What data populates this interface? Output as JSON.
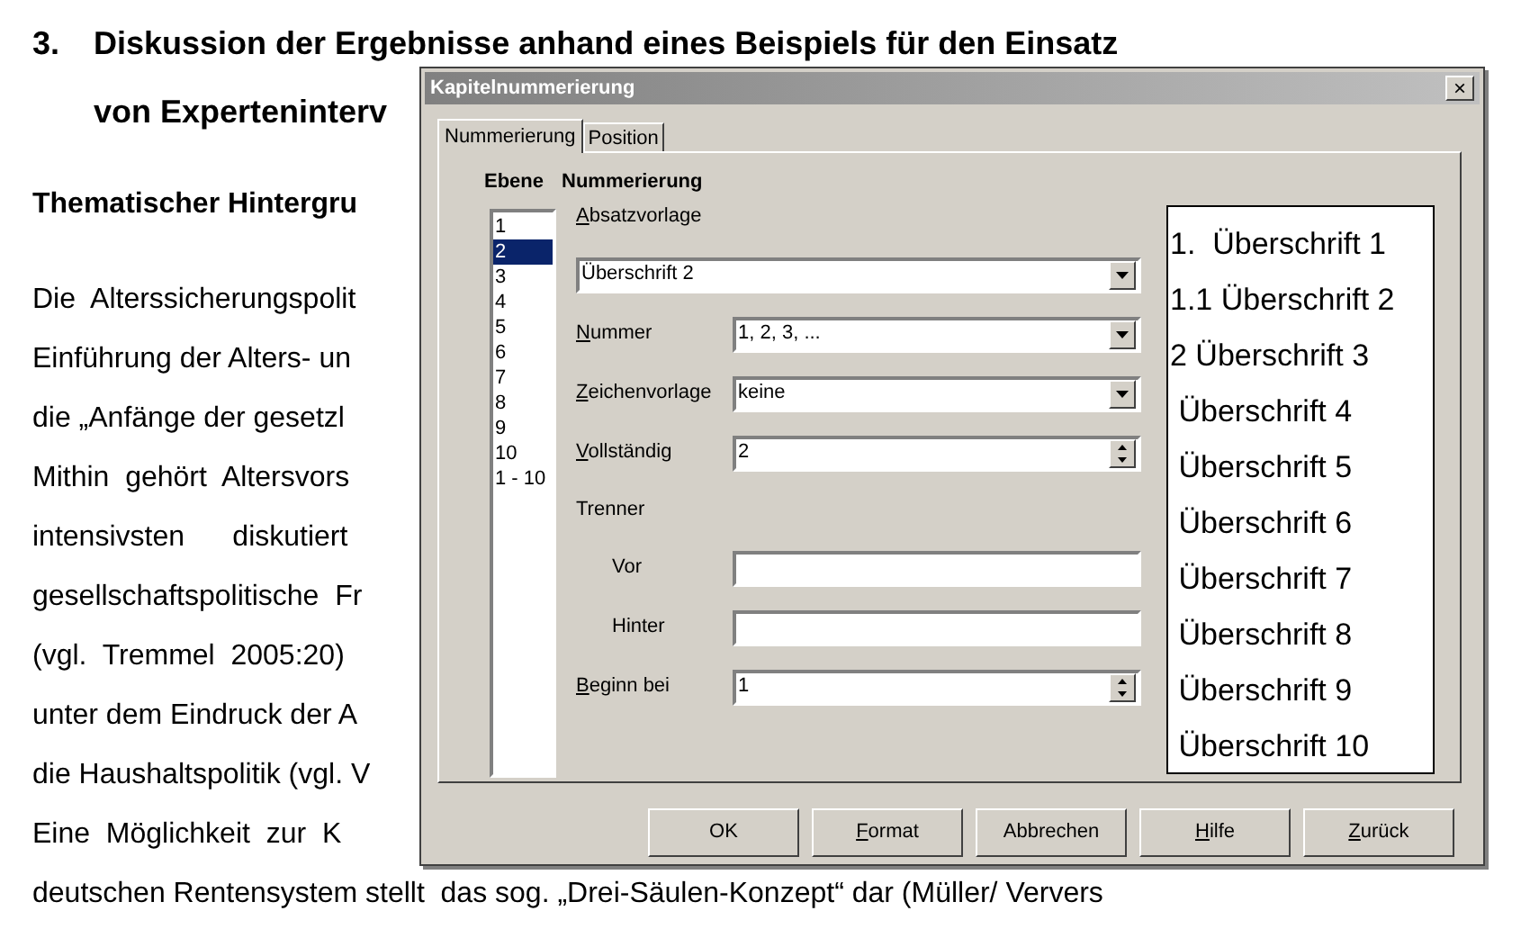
{
  "document": {
    "heading_number": "3.",
    "heading_lines": [
      "Diskussion der Ergebnisse anhand eines Beispiels für den Einsatz",
      "von Experteninterv"
    ],
    "subheading": "Thematischer Hintergru",
    "lines": [
      "Die  Alterssicherungspolit",
      "Einführung der Alters- un",
      "die „Anfänge der gesetzl",
      "Mithin  gehört  Altersvors",
      "intensivsten      diskutiert",
      "gesellschaftspolitische  Fr",
      "(vgl.  Tremmel  2005:20)",
      "unter dem Eindruck der A",
      "die Haushaltspolitik (vgl. V",
      "Eine  Möglichkeit  zur  K",
      "deutschen Rentensystem stellt  das sog. „Drei-Säulen-Konzept“ dar (Müller/ Ververs"
    ]
  },
  "dialog": {
    "title": "Kapitelnummerierung",
    "close": "×",
    "tabs": [
      {
        "label": "Nummerierung",
        "selected": true
      },
      {
        "label": "Position",
        "selected": false
      }
    ],
    "level_header": "Ebene",
    "numbering_header": "Nummerierung",
    "levels": [
      {
        "label": "1",
        "selected": false
      },
      {
        "label": "2",
        "selected": true
      },
      {
        "label": "3",
        "selected": false
      },
      {
        "label": "4",
        "selected": false
      },
      {
        "label": "5",
        "selected": false
      },
      {
        "label": "6",
        "selected": false
      },
      {
        "label": "7",
        "selected": false
      },
      {
        "label": "8",
        "selected": false
      },
      {
        "label": "9",
        "selected": false
      },
      {
        "label": "10",
        "selected": false
      },
      {
        "label": "1 - 10",
        "selected": false
      }
    ],
    "fields": [
      {
        "kind": "label",
        "label": "Absatzvorlage",
        "accel": true
      },
      {
        "kind": "select-wide",
        "value": "Überschrift 2"
      },
      {
        "kind": "select",
        "label": "Nummer",
        "accel": true,
        "value": "1, 2, 3, ..."
      },
      {
        "kind": "select",
        "label": "Zeichenvorlage",
        "accel": true,
        "value": "keine"
      },
      {
        "kind": "spin",
        "label": "Vollständig",
        "accel": true,
        "value": "2"
      },
      {
        "kind": "label",
        "label": "Trenner",
        "accel": false
      },
      {
        "kind": "text",
        "label": "Vor",
        "accel": false
      },
      {
        "kind": "text",
        "label": "Hinter",
        "accel": false
      },
      {
        "kind": "spin",
        "label": "Beginn bei",
        "accel": true,
        "value": "1"
      }
    ],
    "preview": [
      "1.  Überschrift 1",
      "1.1 Überschrift 2",
      "2 Überschrift 3",
      " Überschrift 4",
      " Überschrift 5",
      " Überschrift 6",
      " Überschrift 7",
      " Überschrift 8",
      " Überschrift 9",
      " Überschrift 10"
    ],
    "buttons": [
      {
        "label": "OK",
        "accel": false
      },
      {
        "label": "Format",
        "accel": true
      },
      {
        "label": "Abbrechen",
        "accel": false
      },
      {
        "label": "Hilfe",
        "accel": true
      },
      {
        "label": "Zurück",
        "accel": true
      }
    ]
  }
}
